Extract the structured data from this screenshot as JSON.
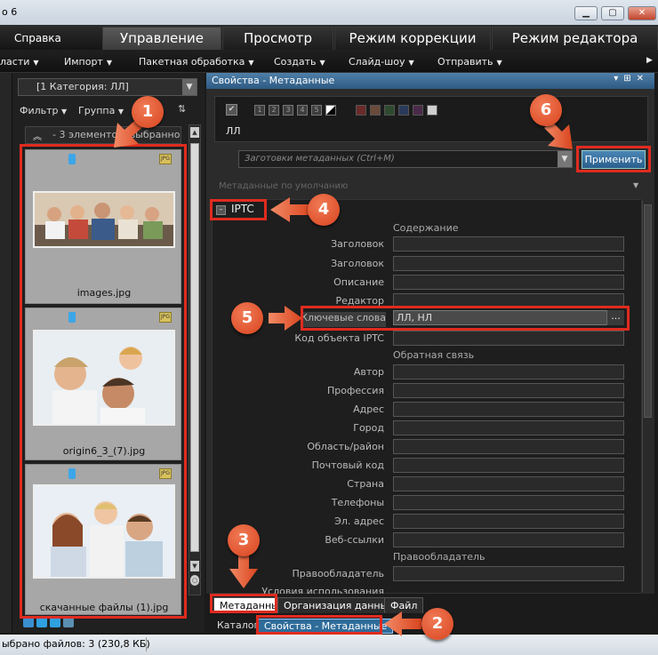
{
  "window": {
    "title": "о 6",
    "min": "▁",
    "max": "▢",
    "close": "✕"
  },
  "menu": {
    "help": "Справка"
  },
  "modes": [
    "Управление",
    "Просмотр",
    "Режим коррекции",
    "Режим редактора"
  ],
  "toolbar": [
    "ласти",
    "Импорт",
    "Пакетная обработка",
    "Создать",
    "Слайд-шоу",
    "Отправить"
  ],
  "left": {
    "category": "[1 Категория: ЛЛ]",
    "filter": "Фильтр",
    "group": "Группа",
    "collapse_text": "- 3 элементов, выбранно",
    "items": [
      {
        "name": "images.jpg",
        "type": "JPG"
      },
      {
        "name": "origin6_3_(7).jpg",
        "type": "JPG"
      },
      {
        "name": "скачанные файлы (1).jpg",
        "type": "JPG"
      }
    ]
  },
  "panel": {
    "title": "Свойства - Метаданные",
    "ratings": [
      "1",
      "2",
      "3",
      "4",
      "5"
    ],
    "label_text": "ЛЛ",
    "preset_placeholder": "Заготовки метаданных (Ctrl+M)",
    "apply": "Применить",
    "defaults": "Метаданные по умолчанию",
    "iptc": "IPTC",
    "sections": {
      "content": "Содержание",
      "feedback": "Обратная связь",
      "copyright": "Правообладатель"
    },
    "fields": {
      "headline1": "Заголовок",
      "headline2": "Заголовок",
      "description": "Описание",
      "editor": "Редактор",
      "keywords": "Ключевые слова",
      "keywords_value": "ЛЛ, НЛ",
      "object_code": "Код объекта IPTC",
      "author": "Автор",
      "profession": "Профессия",
      "address": "Адрес",
      "city": "Город",
      "region": "Область/район",
      "postcode": "Почтовый код",
      "country": "Страна",
      "phones": "Телефоны",
      "email": "Эл. адрес",
      "web": "Веб-ссылки",
      "rights_holder": "Правообладатель",
      "usage": "Условия использования"
    },
    "more": "..."
  },
  "tabs": {
    "metadata": "Метаданные",
    "organize": "Организация данных",
    "file": "Файл"
  },
  "panel_tabs": {
    "catalog": "Каталог",
    "props": "Свойства - Метаданные"
  },
  "status": "ыбрано файлов: 3 (230,8 КБ)",
  "callouts": [
    "1",
    "2",
    "3",
    "4",
    "5",
    "6"
  ],
  "colors": {
    "accent": "#e02b20",
    "callout": "#e2532c",
    "selected_tab": "#2f6c9a"
  }
}
